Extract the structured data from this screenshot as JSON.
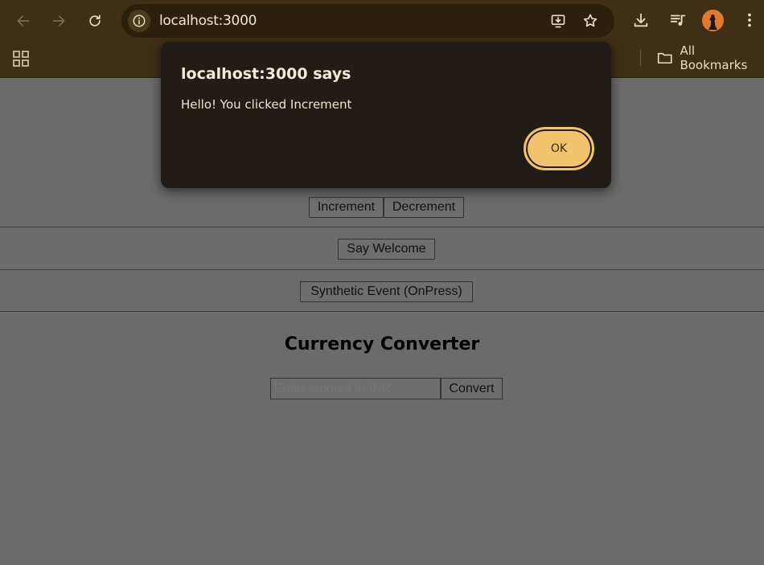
{
  "browser": {
    "url": "localhost:3000",
    "bookmarks_label": "All Bookmarks"
  },
  "page": {
    "counter_buttons": [
      "Increment",
      "Decrement"
    ],
    "say_welcome_label": "Say Welcome",
    "synthetic_event_label": "Synthetic Event (OnPress)",
    "currency_heading": "Currency Converter",
    "amount_placeholder": "Enter amount in INR",
    "convert_label": "Convert"
  },
  "dialog": {
    "title": "localhost:3000 says",
    "message": "Hello! You clicked Increment",
    "ok_label": "OK"
  },
  "colors": {
    "chrome": "#3f3015",
    "dialog_bg": "#211c15",
    "ok_accent": "#f1c36c",
    "page_dim": "#6b6b6b"
  }
}
